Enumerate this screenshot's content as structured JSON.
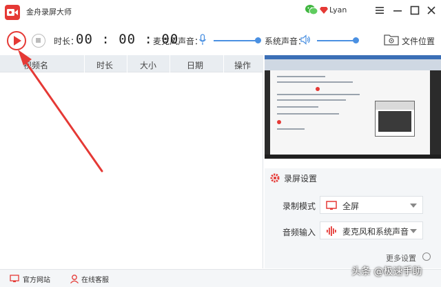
{
  "app": {
    "title": "金舟录屏大师"
  },
  "user": {
    "name": "Lyan"
  },
  "toolbar": {
    "duration_label": "时长：",
    "duration_value": "00 : 00 : 00",
    "mic_label": "麦克风声音：",
    "mic_level": 1.0,
    "system_label": "系统声音：",
    "system_level": 1.0,
    "folder_label": "文件位置"
  },
  "table": {
    "columns": [
      "视频名",
      "时长",
      "大小",
      "日期",
      "操作"
    ],
    "rows": []
  },
  "settings": {
    "title": "录屏设置",
    "mode_label": "录制模式",
    "mode_value": "全屏",
    "audio_label": "音频输入",
    "audio_value": "麦克风和系统声音",
    "more_label": "更多设置"
  },
  "footer": {
    "website_label": "官方网站",
    "service_label": "在线客服"
  },
  "watermark": "头条 @极速手助",
  "colors": {
    "accent": "#e53935",
    "slider": "#4a90e2"
  }
}
